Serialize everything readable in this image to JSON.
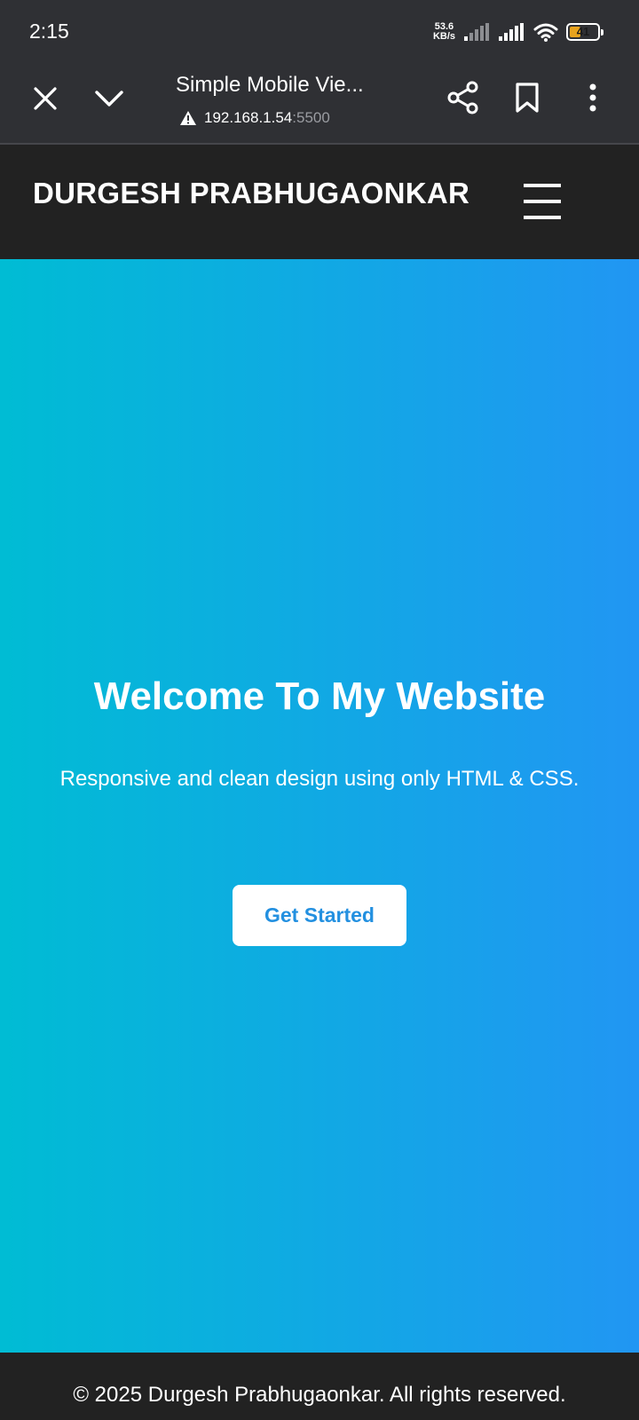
{
  "status_bar": {
    "time": "2:15",
    "net_speed_value": "53.6",
    "net_speed_unit": "KB/s",
    "battery_level": "41",
    "battery_fraction": 0.41,
    "battery_color": "#e8a31e",
    "icons": [
      "signal-weak-icon",
      "signal-full-icon",
      "wifi-icon",
      "battery-icon"
    ]
  },
  "browser": {
    "page_title": "Simple Mobile Vie...",
    "url_host": "192.168.1.54",
    "url_port": ":5500",
    "icons": [
      "close-icon",
      "chevron-down-icon",
      "warning-icon",
      "share-icon",
      "bookmark-icon",
      "more-vertical-icon"
    ]
  },
  "site": {
    "logo": "DURGESH PRABHUGAONKAR",
    "menu_icon": "hamburger-menu-icon",
    "header_bg": "#222222"
  },
  "hero": {
    "title": "Welcome To My Website",
    "subtitle": "Responsive and clean design using only HTML & CSS.",
    "button_label": "Get Started",
    "gradient_start": "#00bcd4",
    "gradient_end": "#2196f3",
    "button_text_color": "#2390e0"
  },
  "footer": {
    "text": "© 2025 Durgesh Prabhugaonkar. All rights reserved."
  }
}
